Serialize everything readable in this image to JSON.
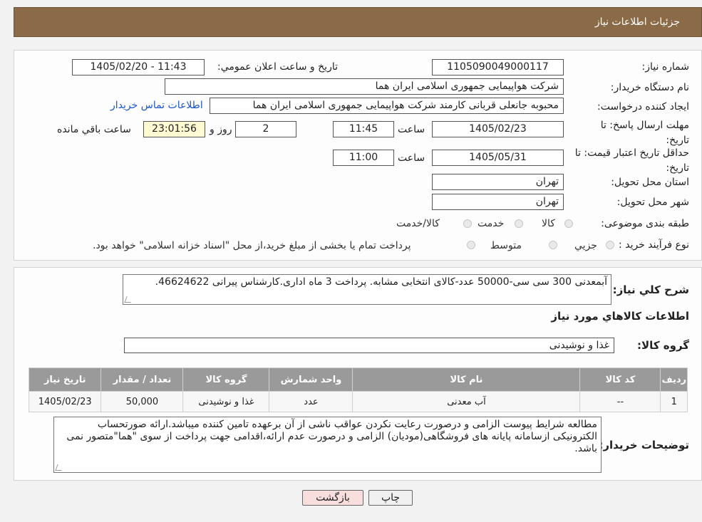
{
  "header": {
    "title": "جزئیات اطلاعات نیاز"
  },
  "fields": {
    "need_number_label": "شماره نیاز:",
    "need_number": "1105090049000117",
    "announce_label": "تاريخ و ساعت اعلان عمومي:",
    "announce_value": "1405/02/20 - 11:43",
    "buyer_org_label": "نام دستگاه خريدار:",
    "buyer_org": "شرکت هواپیمایی جمهوری اسلامی ایران هما",
    "creator_label": "ايجاد کننده درخواست:",
    "creator": "محبوبه جانعلی قربانی کارمند شرکت هواپیمایی جمهوری اسلامی ایران هما",
    "contact_link": "اطلاعات تماس خریدار",
    "deadline_label": "مهلت ارسال پاسخ: تا تاريخ:",
    "deadline_date": "1405/02/23",
    "time_label": "ساعت",
    "deadline_time": "11:45",
    "days_value": "2",
    "days_label": "روز و",
    "remaining_time": "23:01:56",
    "remaining_label": "ساعت باقي مانده",
    "validity_label": "حداقل تاريخ اعتبار قيمت: تا تاريخ:",
    "validity_date": "1405/05/31",
    "validity_time": "11:00",
    "province_label": "استان محل تحويل:",
    "province": "تهران",
    "city_label": "شهر محل تحويل:",
    "city": "تهران",
    "category_label": "طبقه بندی موضوعی:",
    "category_options": [
      "کالا",
      "خدمت",
      "کالا/خدمت"
    ],
    "process_label": "نوع فرآيند خريد :",
    "process_options": [
      "جزيي",
      "متوسط"
    ],
    "process_note": "پرداخت تمام يا بخشی از مبلغ خريد،از محل \"اسناد خزانه اسلامی\" خواهد بود."
  },
  "summary": {
    "label": "شرح کلي نياز:",
    "text": "آبمعدنی 300 سی سی-50000 عدد-کالای انتخابی مشابه. پرداخت 3 ماه اداری.کارشناس پیرانی 46624622."
  },
  "goods": {
    "section_title": "اطلاعات کالاهاي مورد نياز",
    "group_label": "گروه کالا:",
    "group_value": "غذا و نوشیدنی",
    "columns": [
      "رديف",
      "کد کالا",
      "نام کالا",
      "واحد شمارش",
      "گروه کالا",
      "تعداد / مقدار",
      "تاريخ نياز"
    ],
    "rows": [
      [
        "1",
        "--",
        "آب معدنی",
        "عدد",
        "غذا و نوشیدنی",
        "50,000",
        "1405/02/23"
      ]
    ]
  },
  "buyer_notes": {
    "label": "توضيحات خريدار:",
    "text": "مطالعه شرایط پیوست الزامی و درصورت رعایت نکردن عواقب ناشی از آن برعهده تامین کننده میباشد.ارائه صورتحساب الکترونیکی ازسامانه پایانه های فروشگاهی(مودیان) الزامی و درصورت عدم ارائه،اقدامی جهت پرداخت از سوی \"هما\"متصور نمی باشد."
  },
  "buttons": {
    "print": "چاپ",
    "back": "بازگشت"
  },
  "colors": {
    "header": "#8b6b47",
    "link": "#1a56c8",
    "yellow": "#fffbd3",
    "back_button": "#f9dede"
  }
}
